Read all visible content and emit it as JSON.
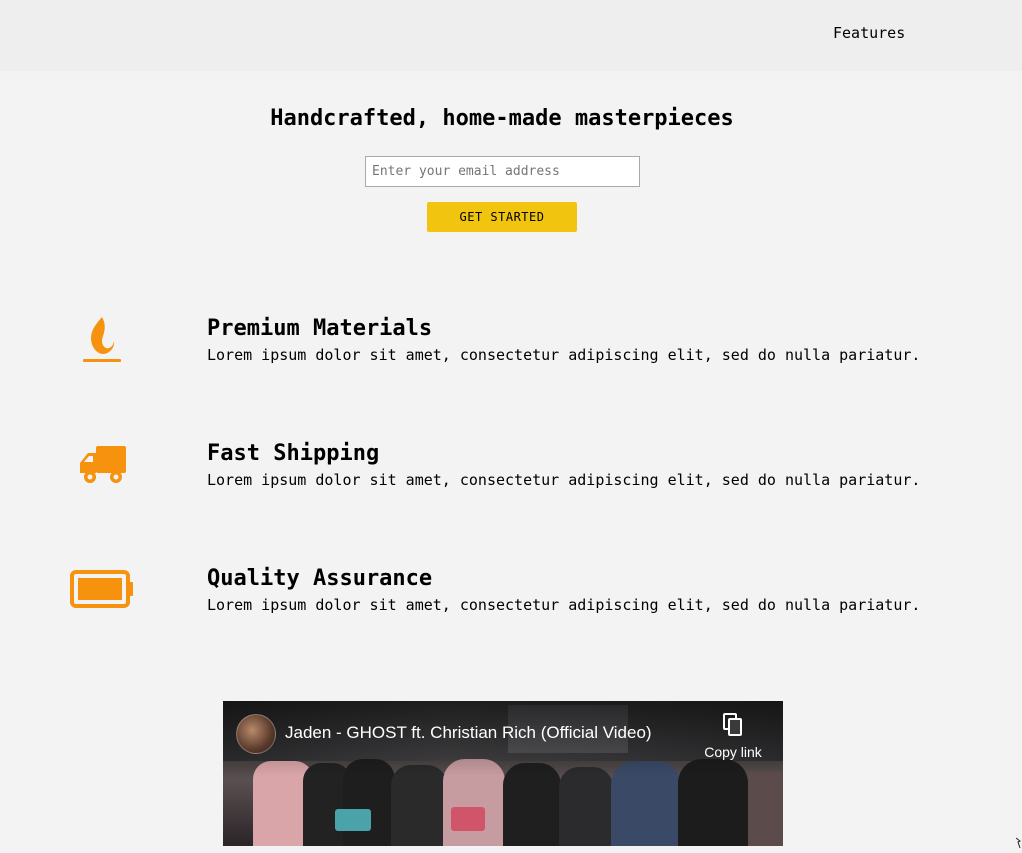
{
  "nav": {
    "features_label": "Features"
  },
  "hero": {
    "title": "Handcrafted, home-made masterpieces",
    "email_placeholder": "Enter your email address",
    "cta_label": "GET STARTED"
  },
  "features": [
    {
      "icon": "fire-icon",
      "title": "Premium Materials",
      "description": "Lorem ipsum dolor sit amet, consectetur adipiscing elit, sed do nulla pariatur."
    },
    {
      "icon": "truck-icon",
      "title": "Fast Shipping",
      "description": "Lorem ipsum dolor sit amet, consectetur adipiscing elit, sed do nulla pariatur."
    },
    {
      "icon": "battery-full-icon",
      "title": "Quality Assurance",
      "description": "Lorem ipsum dolor sit amet, consectetur adipiscing elit, sed do nulla pariatur."
    }
  ],
  "video": {
    "title": "Jaden - GHOST ft. Christian Rich (Official Video)",
    "copy_link_label": "Copy link"
  },
  "colors": {
    "accent_orange": "#f7920f",
    "cta_yellow": "#f1c40f",
    "page_background": "#f3f3f3",
    "header_background": "#eeeeee"
  }
}
